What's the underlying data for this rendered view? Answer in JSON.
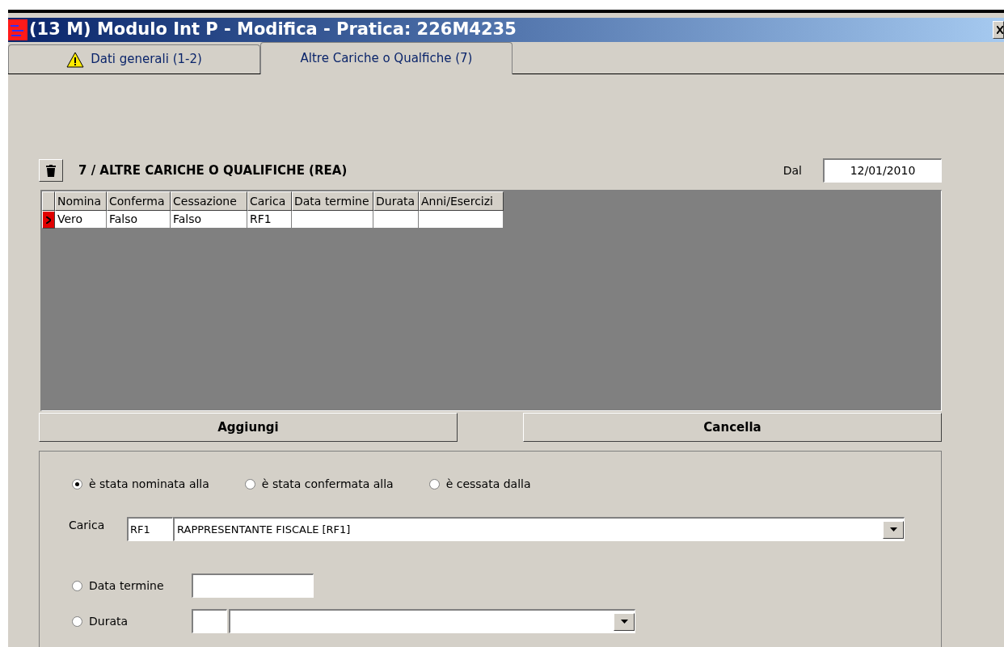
{
  "window": {
    "title": "(13 M) Modulo Int P - Modifica - Pratica: 226M4235"
  },
  "tabs": [
    {
      "label": "Dati generali (1-2)",
      "warning": true,
      "selected": false
    },
    {
      "label": "Altre Cariche o Qualfiche (7)",
      "warning": false,
      "selected": true
    }
  ],
  "section": {
    "title": "7 / ALTRE CARICHE O QUALIFICHE (REA)",
    "date_label": "Dal",
    "date_value": "12/01/2010"
  },
  "table": {
    "columns": [
      "Nomina",
      "Conferma",
      "Cessazione",
      "Carica",
      "Data termine",
      "Durata",
      "Anni/Esercizi"
    ],
    "rows": [
      {
        "selected": true,
        "cells": [
          "Vero",
          "Falso",
          "Falso",
          "RF1",
          "",
          "",
          ""
        ]
      }
    ]
  },
  "buttons": [
    "Aggiungi",
    "Cancella"
  ],
  "type_options": [
    {
      "label": "è stata nominata alla",
      "selected": true
    },
    {
      "label": "è stata confermata alla",
      "selected": false
    },
    {
      "label": "è cessata dalla",
      "selected": false
    }
  ],
  "carica": {
    "label": "Carica",
    "code": "RF1",
    "value": "RAPPRESENTANTE FISCALE [RF1]"
  },
  "term_options": [
    {
      "label": "Data termine",
      "selected": false
    },
    {
      "label": "Durata",
      "selected": false
    }
  ]
}
